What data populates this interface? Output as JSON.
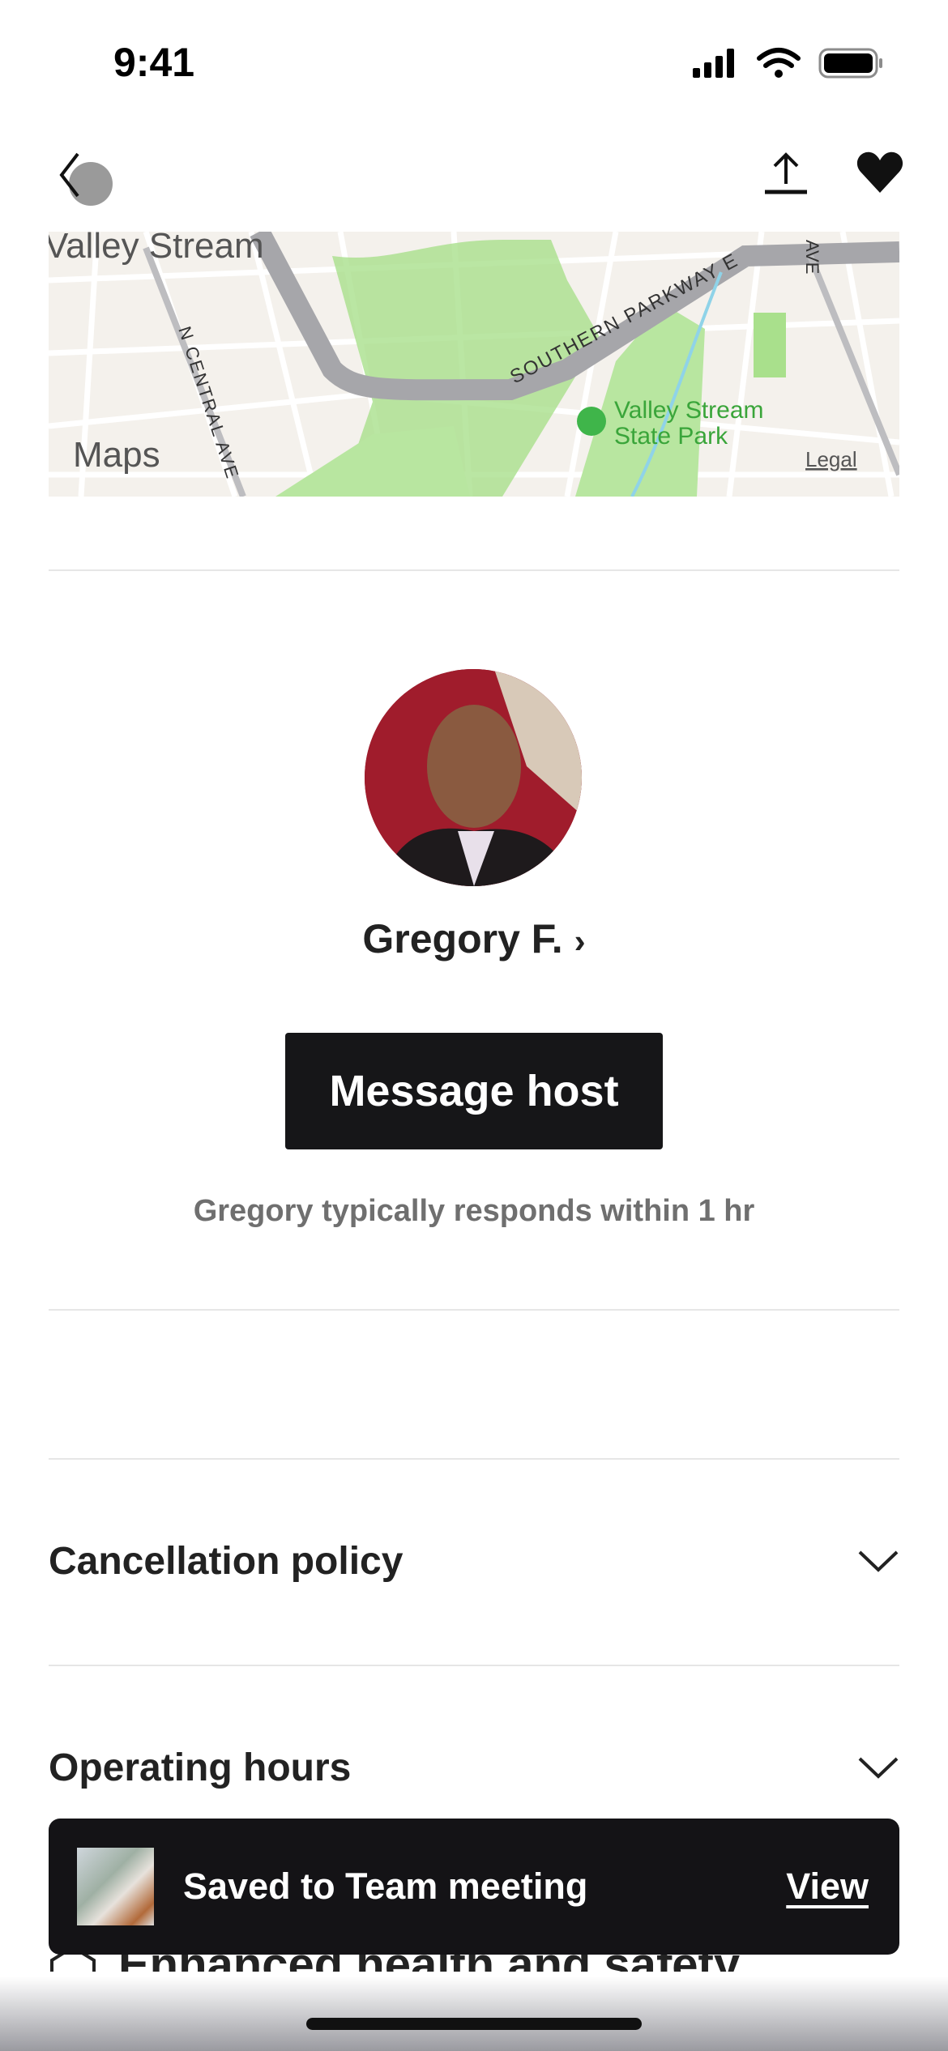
{
  "status_bar": {
    "time": "9:41"
  },
  "nav": {
    "back_icon": "chevron-left-icon",
    "share_icon": "share-icon",
    "favorite_icon": "heart-filled-icon"
  },
  "map": {
    "labels": {
      "town": "Valley Stream",
      "road1": "SOUTHERN PARKWAY E",
      "road2": "N CENTRAL AVE",
      "road3": "AVE",
      "park": "Valley Stream State Park",
      "brand": "Maps",
      "legal": "Legal"
    },
    "colors": {
      "land": "#f4f1ec",
      "park": "#a9e08c",
      "highway": "#a6a6aa",
      "park_label": "#3aa53a"
    }
  },
  "host": {
    "name": "Gregory F.",
    "message_button": "Message host",
    "response_note": "Gregory typically responds within 1 hr"
  },
  "sections": [
    {
      "label": "Cancellation policy"
    },
    {
      "label": "Operating hours"
    },
    {
      "label": "Enhanced health and safety"
    }
  ],
  "toast": {
    "message": "Saved to Team meeting",
    "action": "View"
  }
}
